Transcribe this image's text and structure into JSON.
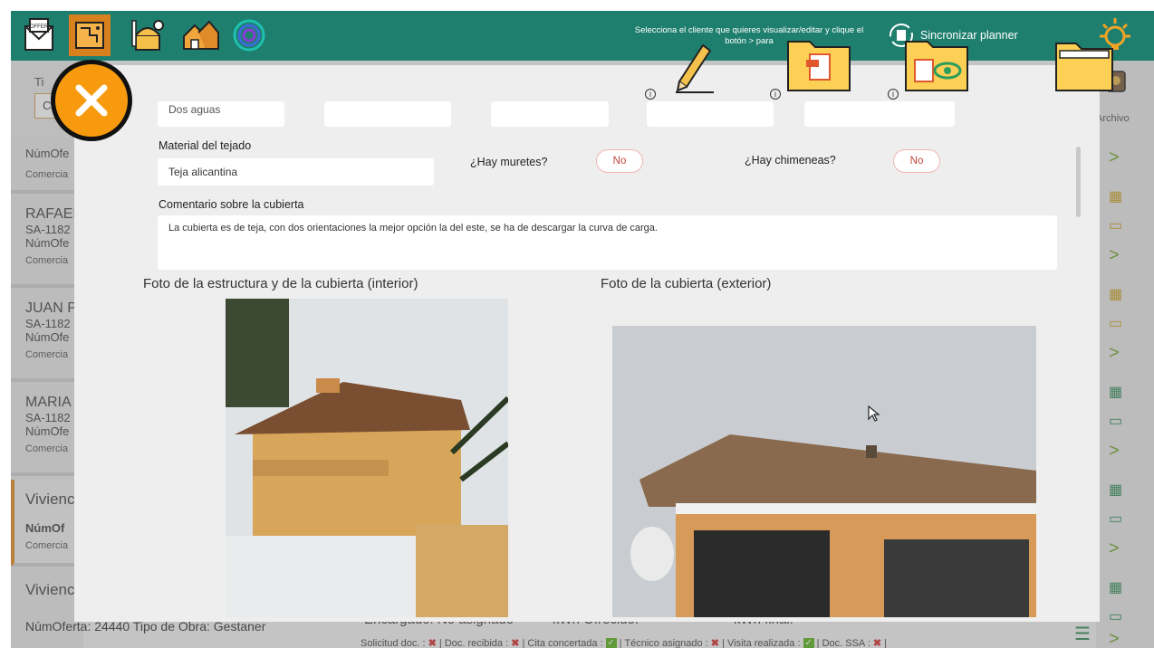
{
  "header": {
    "hint": "Selecciona el cliente que quieres visualizar/editar y clique el botón > para",
    "sync_label": "Sincronizar planner",
    "apps": [
      "offer-icon",
      "blueprint-icon",
      "tools-icon",
      "houses-icon",
      "spiral-icon"
    ]
  },
  "left": {
    "filter_label": "Ti",
    "filter_value": "Cl",
    "cards": [
      {
        "name": "",
        "code": "",
        "offer": "NúmOfe",
        "sales": "Comercia"
      },
      {
        "name": "RAFAEL",
        "code": "SA-1182",
        "offer": "NúmOfe",
        "sales": "Comercia"
      },
      {
        "name": "JUAN P",
        "code": "SA-1182",
        "offer": "NúmOfe",
        "sales": "Comercia"
      },
      {
        "name": "MARIA",
        "code": "SA-1182",
        "offer": "NúmOfe",
        "sales": "Comercia"
      },
      {
        "name": "Vivienc",
        "code": "",
        "offer": "NúmOf",
        "sales": "Comercia"
      },
      {
        "name": "Vivienc",
        "code": "",
        "offer": "",
        "sales": ""
      }
    ]
  },
  "right": {
    "archive_label": "Archivo"
  },
  "modal": {
    "top_fields": [
      "Dos aguas",
      "",
      "",
      "",
      ""
    ],
    "roof_material_label": "Material del tejado",
    "roof_material_value": "Teja alicantina",
    "walls_q": "¿Hay muretes?",
    "walls_a": "No",
    "chimney_q": "¿Hay chimeneas?",
    "chimney_a": "No",
    "comment_label": "Comentario sobre la cubierta",
    "comment_value": "La cubierta es de teja, con dos orientaciones la mejor opción la del este, se ha de descargar la curva de carga.",
    "photo_interior_title": "Foto de la estructura y de la cubierta (interior)",
    "photo_exterior_title": "Foto de la cubierta (exterior)"
  },
  "bottom": {
    "offer_line": "NúmOferta: 24440   Tipo de Obra: Gestaner",
    "encargado": "Encargado: No asignado",
    "kwh_offered": "kWh Ofrecido:",
    "kwh_final": "kWh final:",
    "status_items": [
      {
        "label": "Solicitud doc. :",
        "ok": false
      },
      {
        "label": "Doc. recibida :",
        "ok": false
      },
      {
        "label": "Cita concertada :",
        "ok": true
      },
      {
        "label": "Técnico asignado :",
        "ok": false
      },
      {
        "label": "Visita realizada :",
        "ok": true
      },
      {
        "label": "Doc. SSA :",
        "ok": false
      }
    ]
  },
  "colors": {
    "header": "#1f7f6e",
    "accent": "#f79a0e",
    "active_tab": "#d7801d",
    "nav_green": "#6da52a"
  }
}
